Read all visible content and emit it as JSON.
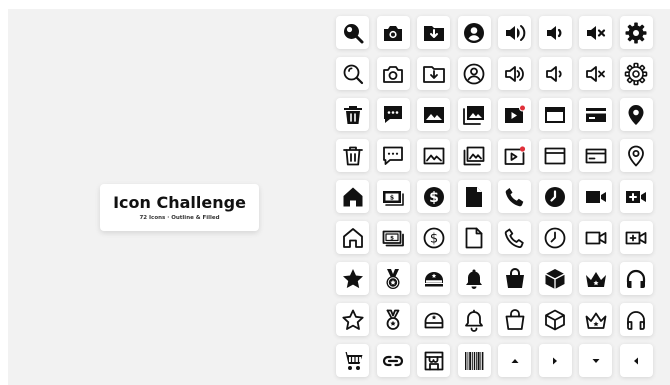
{
  "title_card": {
    "title": "Icon Challenge",
    "subtitle": "72 Icons  ·  Outline & Filled"
  },
  "colors": {
    "background": "#f2f2f2",
    "tile": "#ffffff",
    "icon": "#111111",
    "badge": "#e0303a"
  },
  "icon_rows": [
    [
      "search-filled-icon",
      "camera-filled-icon",
      "folder-download-filled-icon",
      "user-circle-filled-icon",
      "volume-high-filled-icon",
      "volume-low-filled-icon",
      "volume-mute-filled-icon",
      "settings-filled-icon"
    ],
    [
      "search-outline-icon",
      "camera-outline-icon",
      "folder-download-outline-icon",
      "user-circle-outline-icon",
      "volume-high-outline-icon",
      "volume-low-outline-icon",
      "volume-mute-outline-icon",
      "settings-outline-icon"
    ],
    [
      "trash-filled-icon",
      "chat-filled-icon",
      "image-filled-icon",
      "gallery-filled-icon",
      "video-notification-filled-icon",
      "browser-window-filled-icon",
      "credit-card-filled-icon",
      "location-pin-filled-icon"
    ],
    [
      "trash-outline-icon",
      "chat-outline-icon",
      "image-outline-icon",
      "gallery-outline-icon",
      "video-notification-outline-icon",
      "browser-window-outline-icon",
      "credit-card-outline-icon",
      "location-pin-outline-icon"
    ],
    [
      "home-filled-icon",
      "money-filled-icon",
      "dollar-coin-filled-icon",
      "document-filled-icon",
      "phone-filled-icon",
      "clock-filled-icon",
      "video-camera-filled-icon",
      "video-add-filled-icon"
    ],
    [
      "home-outline-icon",
      "money-outline-icon",
      "dollar-coin-outline-icon",
      "document-outline-icon",
      "phone-outline-icon",
      "clock-outline-icon",
      "video-camera-outline-icon",
      "video-add-outline-icon"
    ],
    [
      "star-filled-icon",
      "medal-filled-icon",
      "cap-filled-icon",
      "bell-filled-icon",
      "shopping-bag-filled-icon",
      "box-filled-icon",
      "crown-filled-icon",
      "headphones-filled-icon"
    ],
    [
      "star-outline-icon",
      "medal-outline-icon",
      "cap-outline-icon",
      "bell-outline-icon",
      "shopping-bag-outline-icon",
      "box-outline-icon",
      "crown-outline-icon",
      "headphones-outline-icon"
    ],
    [
      "shopping-cart-icon",
      "link-icon",
      "store-icon",
      "barcode-icon",
      "caret-up-icon",
      "caret-right-icon",
      "caret-down-icon",
      "caret-left-icon"
    ]
  ]
}
